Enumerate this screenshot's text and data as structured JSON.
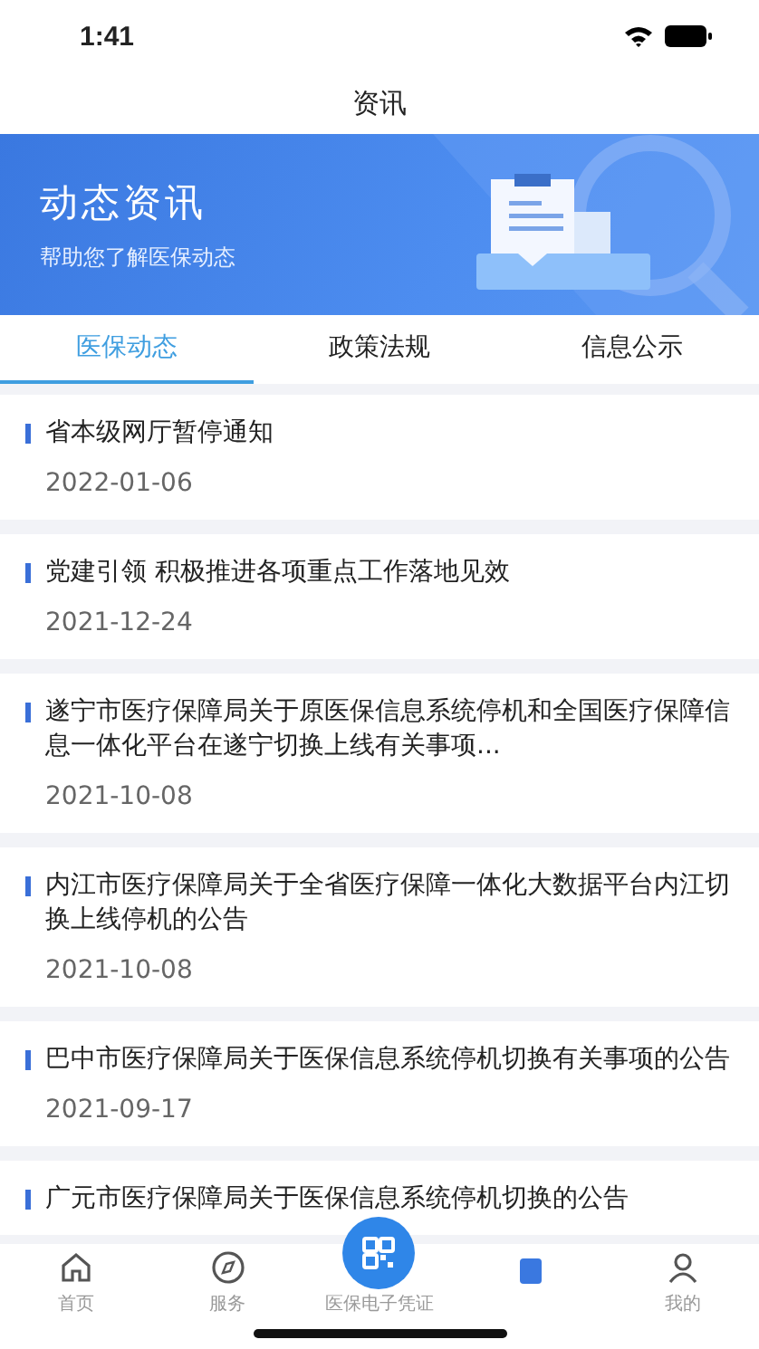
{
  "status_bar": {
    "time": "1:41"
  },
  "nav": {
    "title": "资讯"
  },
  "banner": {
    "title": "动态资讯",
    "subtitle": "帮助您了解医保动态"
  },
  "tabs": [
    {
      "label": "医保动态",
      "selected": true
    },
    {
      "label": "政策法规",
      "selected": false
    },
    {
      "label": "信息公示",
      "selected": false
    }
  ],
  "news": [
    {
      "title": "省本级网厅暂停通知",
      "date": "2022-01-06"
    },
    {
      "title": "党建引领 积极推进各项重点工作落地见效",
      "date": "2021-12-24"
    },
    {
      "title": "遂宁市医疗保障局关于原医保信息系统停机和全国医疗保障信息一体化平台在遂宁切换上线有关事项...",
      "date": "2021-10-08"
    },
    {
      "title": "内江市医疗保障局关于全省医疗保障一体化大数据平台内江切换上线停机的公告",
      "date": "2021-10-08"
    },
    {
      "title": "巴中市医疗保障局关于医保信息系统停机切换有关事项的公告",
      "date": "2021-09-17"
    },
    {
      "title": "广元市医疗保障局关于医保信息系统停机切换的公告"
    }
  ],
  "bottom_nav": [
    {
      "kind": "home",
      "label": "首页"
    },
    {
      "kind": "service",
      "label": "服务"
    },
    {
      "kind": "qr",
      "label": "医保电子凭证"
    },
    {
      "kind": "note"
    },
    {
      "kind": "me",
      "label": "我的"
    }
  ]
}
